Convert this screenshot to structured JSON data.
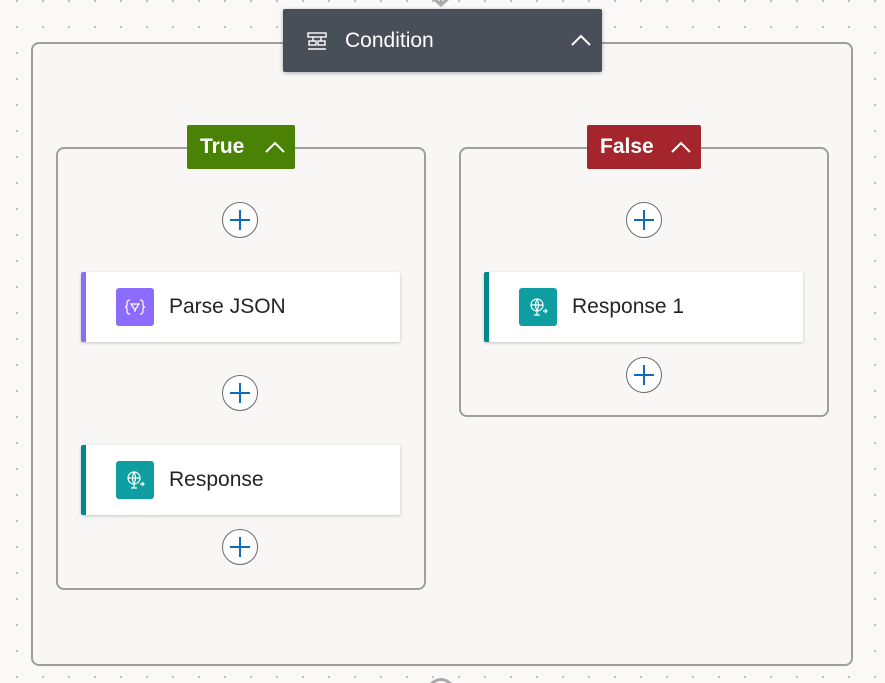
{
  "condition": {
    "title": "Condition",
    "header_color": "#484f58",
    "icon": "condition-icon",
    "collapse_icon": "chevron-up-icon"
  },
  "branches": {
    "true": {
      "label": "True",
      "color": "#498205",
      "actions": [
        {
          "title": "Parse JSON",
          "icon": "parse-json-icon",
          "accent": "#8c6cff",
          "icon_bg": "#8c6cff"
        },
        {
          "title": "Response",
          "icon": "response-icon",
          "accent": "#00888b",
          "icon_bg": "#0e9da0"
        }
      ]
    },
    "false": {
      "label": "False",
      "color": "#a4262c",
      "actions": [
        {
          "title": "Response 1",
          "icon": "response-icon",
          "accent": "#00888b",
          "icon_bg": "#0e9da0"
        }
      ]
    }
  },
  "add_action_icon": "plus-icon",
  "wire_color": "#a9a9ad",
  "plus_color": "#0f6cbd"
}
